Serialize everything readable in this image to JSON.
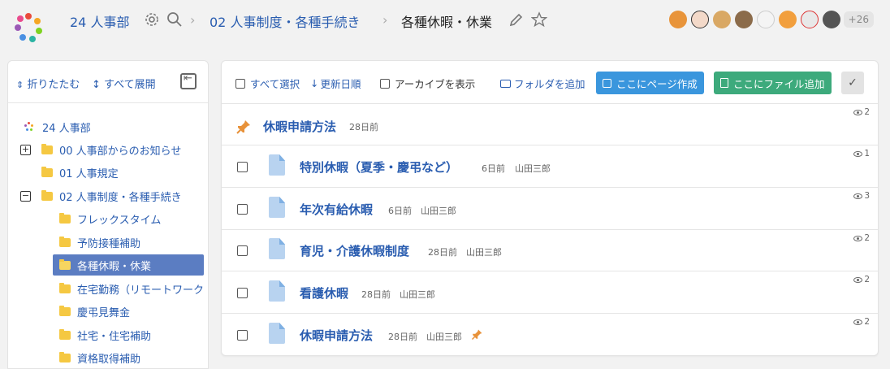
{
  "header": {
    "breadcrumb": [
      "24 人事部",
      "02 人事制度・各種手続き",
      "各種休暇・休業"
    ],
    "more_count": "+26"
  },
  "sidebar": {
    "fold_label": "折りたたむ",
    "expand_label": "すべて展開",
    "tree": [
      {
        "label": "24 人事部"
      },
      {
        "label": "00 人事部からのお知らせ"
      },
      {
        "label": "01 人事規定"
      },
      {
        "label": "02 人事制度・各種手続き"
      },
      {
        "label": "フレックスタイム"
      },
      {
        "label": "予防接種補助"
      },
      {
        "label": "各種休暇・休業"
      },
      {
        "label": "在宅勤務（リモートワーク"
      },
      {
        "label": "慶弔見舞金"
      },
      {
        "label": "社宅・住宅補助"
      },
      {
        "label": "資格取得補助"
      }
    ]
  },
  "toolbar": {
    "select_all": "すべて選択",
    "sort": "更新日順",
    "archive": "アーカイブを表示",
    "add_folder": "フォルダを追加",
    "create_page": "ここにページ作成",
    "add_file": "ここにファイル追加"
  },
  "pinned": {
    "title": "休暇申請方法",
    "date": "28日前",
    "views": "2"
  },
  "rows": [
    {
      "title": "特別休暇（夏季・慶弔など）",
      "date": "6日前",
      "author": "山田三郎",
      "views": "1"
    },
    {
      "title": "年次有給休暇",
      "date": "6日前",
      "author": "山田三郎",
      "views": "3"
    },
    {
      "title": "育児・介護休暇制度",
      "date": "28日前",
      "author": "山田三郎",
      "views": "2"
    },
    {
      "title": "看護休暇",
      "date": "28日前",
      "author": "山田三郎",
      "views": "2"
    },
    {
      "title": "休暇申請方法",
      "date": "28日前",
      "author": "山田三郎",
      "views": "2"
    }
  ]
}
